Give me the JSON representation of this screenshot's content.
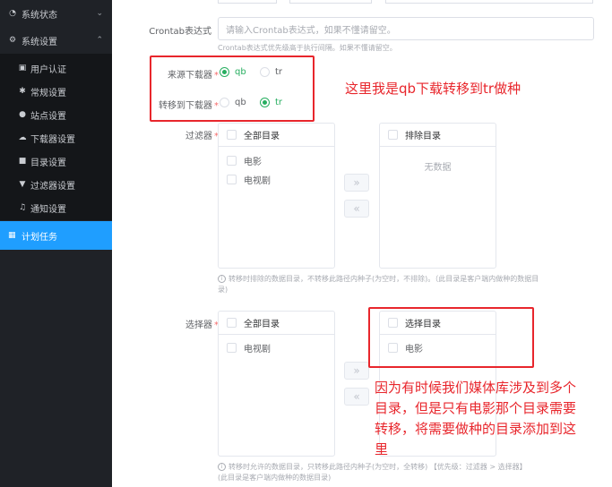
{
  "sidebar": {
    "top_items": [
      {
        "label": "系统状态",
        "icon": "dashboard-icon"
      },
      {
        "label": "系统设置",
        "icon": "gears-icon"
      }
    ],
    "sub_items": [
      {
        "label": "用户认证",
        "icon": "id-card-icon"
      },
      {
        "label": "常规设置",
        "icon": "gear-icon"
      },
      {
        "label": "站点设置",
        "icon": "globe-icon"
      },
      {
        "label": "下载器设置",
        "icon": "cloud-download-icon"
      },
      {
        "label": "目录设置",
        "icon": "folder-icon"
      },
      {
        "label": "过滤器设置",
        "icon": "filter-icon"
      },
      {
        "label": "通知设置",
        "icon": "bell-icon"
      }
    ],
    "active_item": {
      "label": "计划任务",
      "icon": "calendar-icon"
    },
    "colors": {
      "bg": "#1f2227",
      "sub_bg": "#141619",
      "active": "#1f9eff"
    }
  },
  "form": {
    "crontab": {
      "label": "Crontab表达式",
      "placeholder": "请输入Crontab表达式，如果不懂请留空。",
      "hint": "Crontab表达式优先级高于执行间隔。如果不懂请留空。"
    },
    "source_downloader": {
      "label": "来源下载器",
      "required_mark": "*",
      "options": [
        "qb",
        "tr"
      ],
      "selected": "qb"
    },
    "target_downloader": {
      "label": "转移到下载器",
      "required_mark": "*",
      "options": [
        "qb",
        "tr"
      ],
      "selected": "tr"
    },
    "filter": {
      "label": "过滤器",
      "required_mark": "*",
      "left_header": "全部目录",
      "left_items": [
        "电影",
        "电视剧"
      ],
      "right_header": "排除目录",
      "right_empty": "无数据",
      "hint_line1": "转移时排除的数据目录，不转移此路径内种子(为空时，不排除)。（此目录是客户端内做种的数据目",
      "hint_line2": "录)"
    },
    "selector": {
      "label": "选择器",
      "required_mark": "*",
      "left_header": "全部目录",
      "left_items": [
        "电视剧"
      ],
      "right_header": "选择目录",
      "right_items": [
        "电影"
      ],
      "hint_line1": "转移时允许的数据目录，只转移此路径内种子(为空时，全转移) 【优先级：过滤器 > 选择器】",
      "hint_line2": "(此目录是客户端内做种的数据目录)"
    },
    "transfer_buttons": {
      "to_right": "»",
      "to_left": "«"
    },
    "accent_color": "#27ae60"
  },
  "annotations": {
    "top": "这里我是qb下载转移到tr做种",
    "bottom_lines": [
      "因为有时候我们媒体库涉及到多个",
      "目录，但是只有电影那个目录需要",
      "转移，将需要做种的目录添加到这",
      "里"
    ],
    "color": "#e8262c"
  }
}
